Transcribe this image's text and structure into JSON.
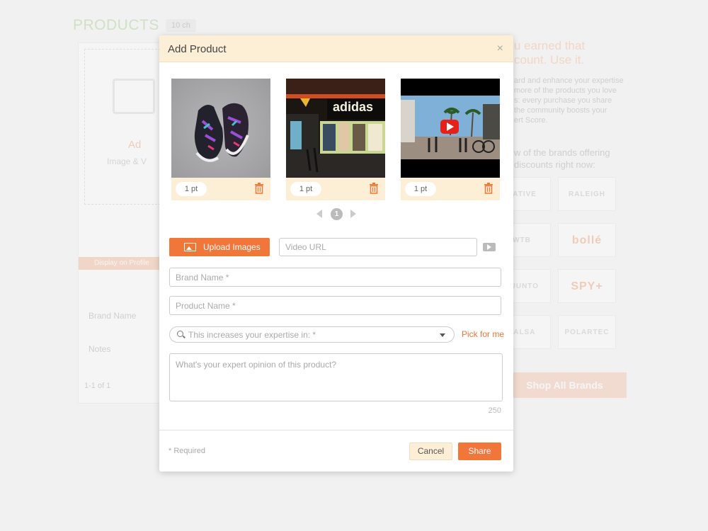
{
  "background": {
    "title": "PRODUCTS",
    "count": "10 ch",
    "add_label": "Ad",
    "add_sub": "Image & V",
    "display_bar": "Display on Profile",
    "field_1": "Brand Name",
    "field_2": "Notes",
    "pager": "1-1 of 1",
    "earned": "u earned that\ncount. Use it.",
    "desc": "ard and enhance your expertise\nmore of the products you love\ns: every purchase you share\nthe community boosts your\nert Score.",
    "brands_head": "w of the brands offering\ndiscounts right now:",
    "brands": [
      "NATIVE",
      "RALEIGH",
      "WTB",
      "bollé",
      "SUUNTO",
      "SPY+",
      "SALSA",
      "POLARTEC"
    ],
    "shop_all": "Shop All Brands"
  },
  "modal": {
    "title": "Add Product",
    "close_glyph": "×",
    "thumbnails": [
      {
        "points": "1 pt",
        "kind": "image"
      },
      {
        "points": "1 pt",
        "kind": "image"
      },
      {
        "points": "1 pt",
        "kind": "video"
      }
    ],
    "storefront_text": "adidas",
    "page_number": "1",
    "upload_label": "Upload Images",
    "video_url_placeholder": "Video URL",
    "brand_placeholder": "Brand Name *",
    "product_placeholder": "Product Name *",
    "expertise_placeholder": "This increases your expertise in: *",
    "pick_for_me": "Pick for me",
    "opinion_placeholder": "What's your expert opinion of this product?",
    "char_count": "250",
    "required_note": "* Required",
    "cancel_label": "Cancel",
    "share_label": "Share"
  },
  "colors": {
    "accent": "#f0763a",
    "header_bg": "#fcefd6",
    "page_bg": "#f1f1f1"
  }
}
